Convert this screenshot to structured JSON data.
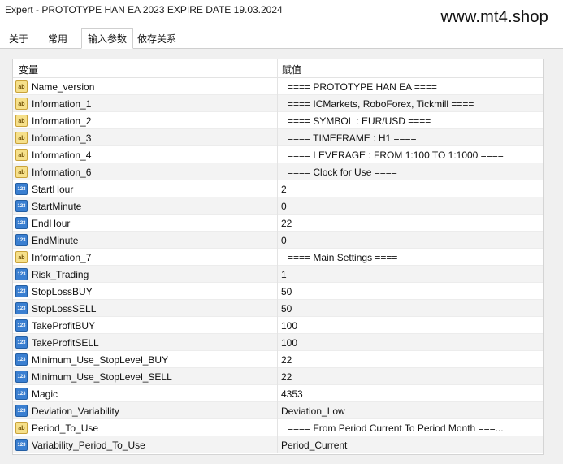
{
  "window": {
    "title": "Expert - PROTOTYPE HAN EA 2023 EXPIRE DATE 19.03.2024",
    "watermark": "www.mt4.shop"
  },
  "tabs": [
    {
      "label": "关于"
    },
    {
      "label": "常用"
    },
    {
      "label": "输入参数"
    },
    {
      "label": "依存关系"
    }
  ],
  "table": {
    "headers": {
      "name": "变量",
      "value": "赋值"
    },
    "rows": [
      {
        "icon": "ab",
        "name": "Name_version",
        "value": "====  PROTOTYPE HAN EA  ===="
      },
      {
        "icon": "ab",
        "name": "Information_1",
        "value": "====  ICMarkets, RoboForex, Tickmill  ===="
      },
      {
        "icon": "ab",
        "name": "Information_2",
        "value": "====  SYMBOL : EUR/USD  ===="
      },
      {
        "icon": "ab",
        "name": "Information_3",
        "value": "====  TIMEFRAME : H1  ===="
      },
      {
        "icon": "ab",
        "name": "Information_4",
        "value": "====  LEVERAGE : FROM 1:100 TO 1:1000  ===="
      },
      {
        "icon": "ab",
        "name": "Information_6",
        "value": "====  Clock for Use  ===="
      },
      {
        "icon": "123",
        "name": "StartHour",
        "value": "2"
      },
      {
        "icon": "123",
        "name": "StartMinute",
        "value": "0"
      },
      {
        "icon": "123",
        "name": "EndHour",
        "value": "22"
      },
      {
        "icon": "123",
        "name": "EndMinute",
        "value": "0"
      },
      {
        "icon": "ab",
        "name": "Information_7",
        "value": "====  Main Settings  ===="
      },
      {
        "icon": "123",
        "name": "Risk_Trading",
        "value": "1"
      },
      {
        "icon": "123",
        "name": "StopLossBUY",
        "value": "50"
      },
      {
        "icon": "123",
        "name": "StopLossSELL",
        "value": "50"
      },
      {
        "icon": "123",
        "name": "TakeProfitBUY",
        "value": "100"
      },
      {
        "icon": "123",
        "name": "TakeProfitSELL",
        "value": "100"
      },
      {
        "icon": "123",
        "name": "Minimum_Use_StopLevel_BUY",
        "value": "22"
      },
      {
        "icon": "123",
        "name": "Minimum_Use_StopLevel_SELL",
        "value": "22"
      },
      {
        "icon": "123",
        "name": "Magic",
        "value": "4353"
      },
      {
        "icon": "123",
        "name": "Deviation_Variability",
        "value": "Deviation_Low"
      },
      {
        "icon": "ab",
        "name": "Period_To_Use",
        "value": "====  From Period Current To Period Month  ===..."
      },
      {
        "icon": "123",
        "name": "Variability_Period_To_Use",
        "value": "Period_Current"
      }
    ]
  },
  "colors": {
    "grid_border": "#d4d4d4",
    "row_alt": "#f3f3f3",
    "icon_string": "#f6e08a",
    "icon_number": "#3a7fd1"
  }
}
